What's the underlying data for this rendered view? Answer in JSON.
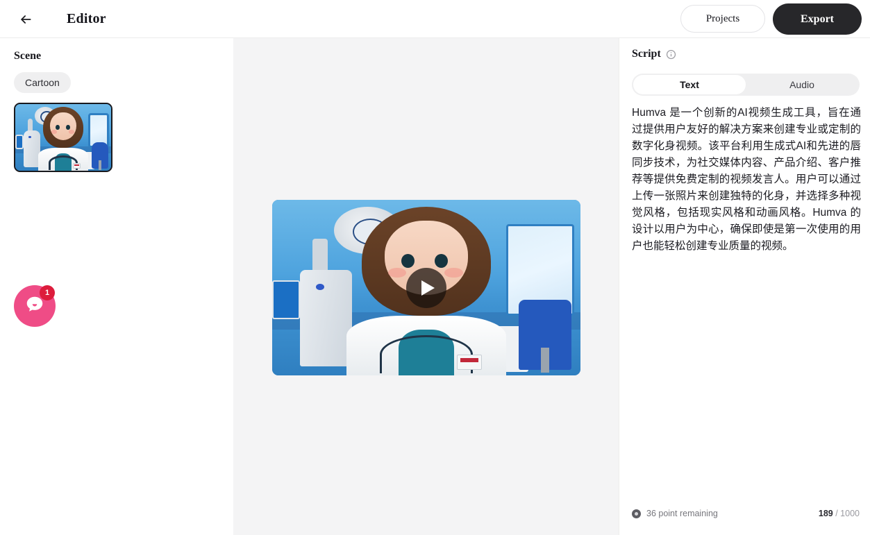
{
  "header": {
    "back_icon": "arrow-left-icon",
    "title": "Editor",
    "projects_label": "Projects",
    "export_label": "Export"
  },
  "sidebar": {
    "scene_label": "Scene",
    "style_tag": "Cartoon",
    "thumbnail_alt": "cartoon doctor scene thumbnail",
    "chat": {
      "icon": "chat-bubble-icon",
      "badge_count": "1",
      "badge_color": "#dd1c3c",
      "bubble_color": "#ef4c86"
    }
  },
  "canvas": {
    "play_icon": "play-icon",
    "video_alt": "cartoon doctor speaking in a blue clinic"
  },
  "right_panel": {
    "script_label": "Script",
    "info_icon": "info-circle-icon",
    "tabs": [
      {
        "label": "Text",
        "active": true
      },
      {
        "label": "Audio",
        "active": false
      }
    ],
    "script_text": "Humva 是一个创新的AI视频生成工具，旨在通过提供用户友好的解决方案来创建专业或定制的数字化身视频。该平台利用生成式AI和先进的唇同步技术，为社交媒体内容、产品介绍、客户推荐等提供免费定制的视频发言人。用户可以通过上传一张照片来创建独特的化身，并选择多种视觉风格，包括现实风格和动画风格。Humva 的设计以用户为中心，确保即使是第一次使用的用户也能轻松创建专业质量的视频。",
    "footer": {
      "coin_icon": "coin-icon",
      "point_text": "36 point remaining",
      "chars_used": "189",
      "chars_limit": "/ 1000"
    }
  },
  "theme": {
    "accent_dark": "#27272a",
    "panel_bg": "#f4f4f5",
    "border": "#ececec"
  }
}
